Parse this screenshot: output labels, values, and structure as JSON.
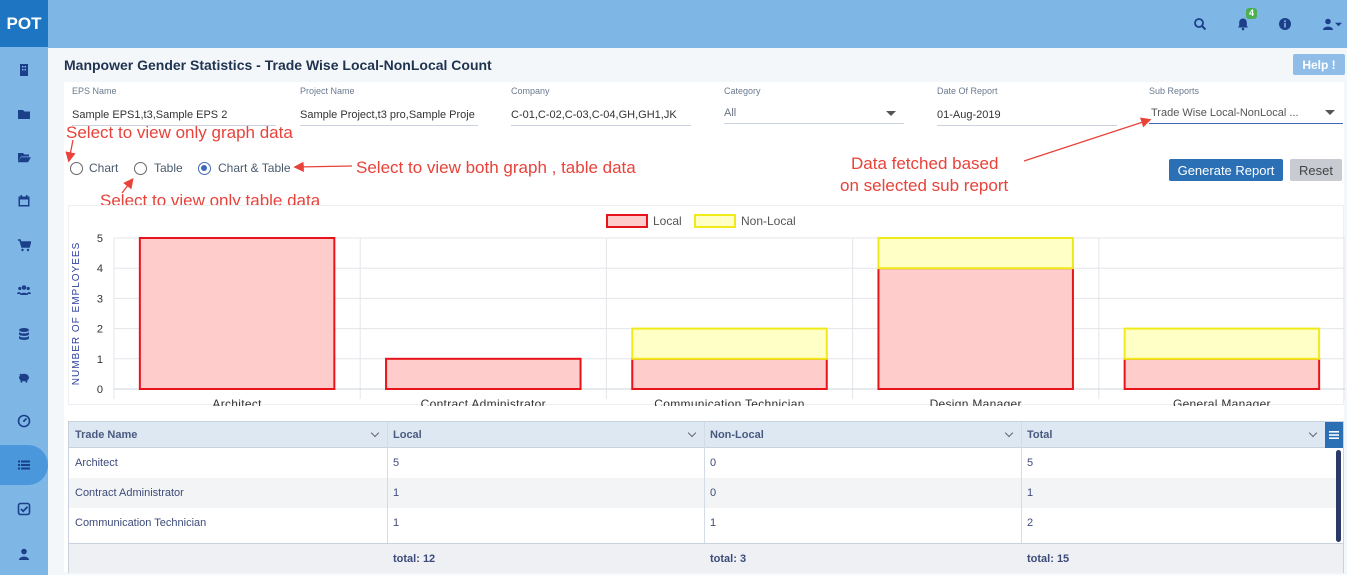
{
  "app": {
    "logo": "POT"
  },
  "sidebar": {
    "items": [
      {
        "name": "sidebar-item-building",
        "icon": "building-icon"
      },
      {
        "name": "sidebar-item-folder",
        "icon": "folder-icon"
      },
      {
        "name": "sidebar-item-folder-open",
        "icon": "folder-open-icon"
      },
      {
        "name": "sidebar-item-calendar",
        "icon": "calendar-icon"
      },
      {
        "name": "sidebar-item-cart",
        "icon": "cart-icon"
      },
      {
        "name": "sidebar-item-users",
        "icon": "users-icon"
      },
      {
        "name": "sidebar-item-database",
        "icon": "database-icon"
      },
      {
        "name": "sidebar-item-piggy-bank",
        "icon": "piggy-bank-icon"
      },
      {
        "name": "sidebar-item-dashboard",
        "icon": "dashboard-icon"
      },
      {
        "name": "sidebar-item-reports",
        "icon": "list-icon",
        "active": true
      },
      {
        "name": "sidebar-item-tasks",
        "icon": "check-square-icon"
      },
      {
        "name": "sidebar-item-user",
        "icon": "user-icon"
      }
    ]
  },
  "topbar": {
    "notification_count": "4",
    "icons": [
      "search-icon",
      "bell-icon",
      "info-icon",
      "user-icon"
    ]
  },
  "page": {
    "title": "Manpower Gender Statistics - Trade Wise Local-NonLocal Count",
    "help_label": "Help !"
  },
  "filters": {
    "eps": {
      "label": "EPS Name",
      "value": "Sample EPS1,t3,Sample EPS 2"
    },
    "project": {
      "label": "Project Name",
      "value": "Sample Project,t3 pro,Sample Proje"
    },
    "company": {
      "label": "Company",
      "value": "C-01,C-02,C-03,C-04,GH,GH1,JK"
    },
    "category": {
      "label": "Category",
      "value": "All"
    },
    "date": {
      "label": "Date Of Report",
      "value": "01-Aug-2019"
    },
    "sub_report": {
      "label": "Sub Reports",
      "value": "Trade Wise Local-NonLocal ..."
    }
  },
  "view_options": {
    "chart": "Chart",
    "table": "Table",
    "both": "Chart & Table",
    "selected": "both"
  },
  "actions": {
    "generate": "Generate Report",
    "reset": "Reset"
  },
  "annotations": {
    "graph_only": "Select to view only graph data",
    "both": "Select to view both graph , table data",
    "table_only": "Select to view only table data",
    "sub_report_line1": "Data fetched based",
    "sub_report_line2": "on selected sub report"
  },
  "colors": {
    "local_fill": "#ffcccc",
    "local_stroke": "#e8141b",
    "nonlocal_fill": "#ffffc6",
    "nonlocal_stroke": "#f0ea1a",
    "topbar": "#7eb6e6",
    "primary_button": "#2b70b4"
  },
  "chart_data": {
    "type": "bar",
    "stacked": true,
    "categories": [
      "Architect",
      "Contract Administrator",
      "Communication Technician",
      "Design Manager",
      "General Manager"
    ],
    "series": [
      {
        "name": "Local",
        "values": [
          5,
          1,
          1,
          4,
          1
        ]
      },
      {
        "name": "Non-Local",
        "values": [
          0,
          0,
          1,
          1,
          1
        ]
      }
    ],
    "ylabel": "NUMBER OF EMPLOYEES",
    "yticks": [
      "0",
      "1",
      "2",
      "3",
      "4",
      "5"
    ],
    "ylim": [
      0,
      5
    ],
    "legend_position": "top-center",
    "grid": true
  },
  "table": {
    "columns": [
      "Trade Name",
      "Local",
      "Non-Local",
      "Total"
    ],
    "rows": [
      [
        "Architect",
        "5",
        "0",
        "5"
      ],
      [
        "Contract Administrator",
        "1",
        "0",
        "1"
      ],
      [
        "Communication Technician",
        "1",
        "1",
        "2"
      ]
    ],
    "footer": [
      "",
      "total: 12",
      "total: 3",
      "total: 15"
    ]
  }
}
